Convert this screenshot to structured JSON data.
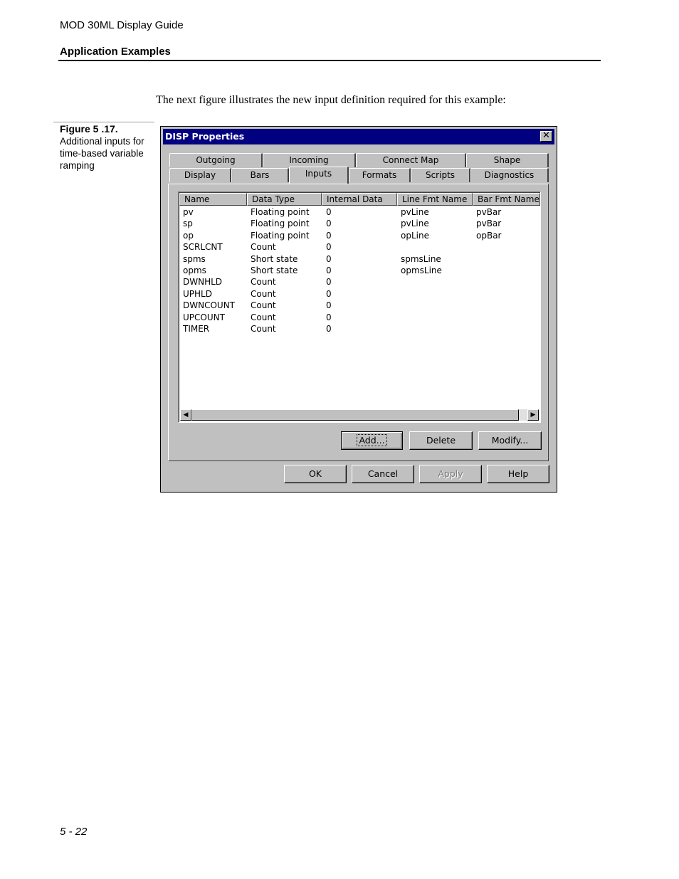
{
  "page": {
    "doc_title": "MOD 30ML Display Guide",
    "section_title": "Application Examples",
    "intro": "The next figure illustrates the new input definition required for this example:",
    "figure_label": "Figure 5 .17.",
    "figure_caption": "Additional inputs for time-based variable ramping",
    "page_number": "5 - 22"
  },
  "dialog": {
    "title": "DISP Properties",
    "close_glyph": "✕",
    "tabs_row1": [
      "Outgoing",
      "Incoming",
      "Connect Map",
      "Shape"
    ],
    "tabs_row2": [
      "Display",
      "Bars",
      "Inputs",
      "Formats",
      "Scripts",
      "Diagnostics"
    ],
    "active_tab": "Inputs",
    "columns": [
      "Name",
      "Data Type",
      "Internal Data",
      "Line Fmt Name",
      "Bar Fmt Name"
    ],
    "rows": [
      [
        "pv",
        "Floating point",
        "0",
        "pvLine",
        "pvBar"
      ],
      [
        "sp",
        "Floating point",
        "0",
        "pvLine",
        "pvBar"
      ],
      [
        "op",
        "Floating point",
        "0",
        "opLine",
        "opBar"
      ],
      [
        "SCRLCNT",
        "Count",
        "0",
        "",
        ""
      ],
      [
        "spms",
        "Short state",
        "0",
        "spmsLine",
        ""
      ],
      [
        "opms",
        "Short state",
        "0",
        "opmsLine",
        ""
      ],
      [
        "DWNHLD",
        "Count",
        "0",
        "",
        ""
      ],
      [
        "UPHLD",
        "Count",
        "0",
        "",
        ""
      ],
      [
        "DWNCOUNT",
        "Count",
        "0",
        "",
        ""
      ],
      [
        "UPCOUNT",
        "Count",
        "0",
        "",
        ""
      ],
      [
        "TIMER",
        "Count",
        "0",
        "",
        ""
      ]
    ],
    "scroll_left_glyph": "◀",
    "scroll_right_glyph": "▶",
    "list_buttons": {
      "add": "Add...",
      "delete": "Delete",
      "modify": "Modify..."
    },
    "footer_buttons": {
      "ok": "OK",
      "cancel": "Cancel",
      "apply": "Apply",
      "help": "Help"
    }
  }
}
